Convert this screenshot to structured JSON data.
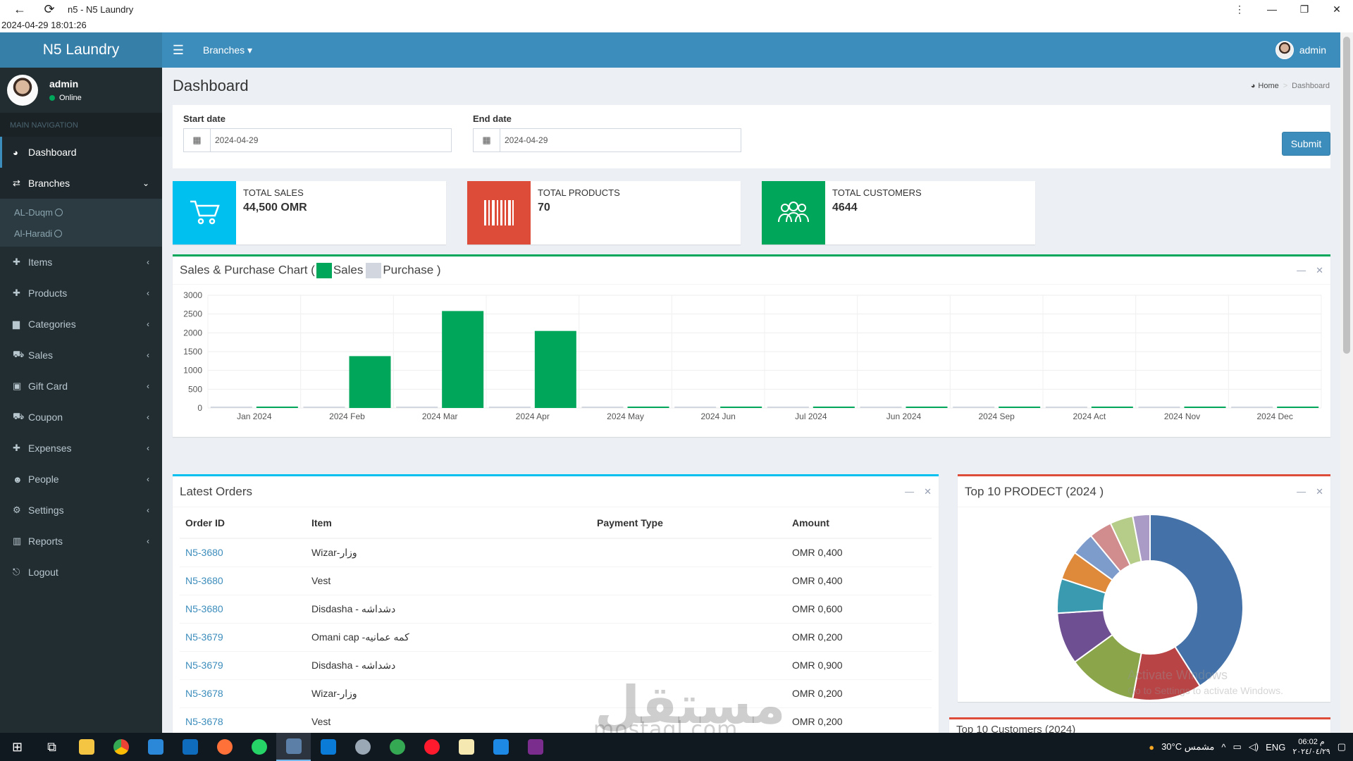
{
  "window": {
    "title": "n5 - N5 Laundry",
    "timestamp": "2024-04-29 18:01:26"
  },
  "header": {
    "logo": "N5 Laundry",
    "branches_label": "Branches ▾",
    "user": "admin"
  },
  "sidebar": {
    "user_name": "admin",
    "user_status": "Online",
    "nav_header": "MAIN NAVIGATION",
    "items": [
      {
        "label": "Dashboard",
        "icon": "dashboard-icon"
      },
      {
        "label": "Branches",
        "icon": "exchange-icon"
      },
      {
        "label": "Items",
        "icon": "plus-icon"
      },
      {
        "label": "Products",
        "icon": "plus-icon"
      },
      {
        "label": "Categories",
        "icon": "folder-icon"
      },
      {
        "label": "Sales",
        "icon": "cart-icon"
      },
      {
        "label": "Gift Card",
        "icon": "gift-icon"
      },
      {
        "label": "Coupon",
        "icon": "cart-icon"
      },
      {
        "label": "Expenses",
        "icon": "plus-icon"
      },
      {
        "label": "People",
        "icon": "users-icon"
      },
      {
        "label": "Settings",
        "icon": "cogs-icon"
      },
      {
        "label": "Reports",
        "icon": "bar-chart-icon"
      },
      {
        "label": "Logout",
        "icon": "logout-icon"
      }
    ],
    "branches_sub": [
      "AL-Duqm",
      "Al-Haradi"
    ]
  },
  "page": {
    "title": "Dashboard",
    "breadcrumb_home": "Home",
    "breadcrumb_current": "Dashboard"
  },
  "filter": {
    "start_label": "Start date",
    "start_value": "2024-04-29",
    "end_label": "End date",
    "end_value": "2024-04-29",
    "submit": "Submit"
  },
  "stats": [
    {
      "label": "TOTAL SALES",
      "value": "44,500 OMR",
      "color": "#00c0ef",
      "icon": "cart-icon"
    },
    {
      "label": "TOTAL PRODUCTS",
      "value": "70",
      "color": "#dd4b39",
      "icon": "barcode-icon"
    },
    {
      "label": "TOTAL CUSTOMERS",
      "value": "4644",
      "color": "#00a65a",
      "icon": "users-icon"
    }
  ],
  "sales_chart": {
    "title_prefix": "Sales & Purchase Chart (",
    "legend_sales": "Sales",
    "legend_purchase": "Purchase )",
    "sales_color": "#00a65a",
    "purchase_color": "#d2d6de"
  },
  "chart_data": [
    {
      "type": "bar",
      "title": "Sales & Purchase Chart",
      "categories": [
        "Jan 2024",
        "2024 Feb",
        "2024 Mar",
        "2024 Apr",
        "2024 May",
        "2024 Jun",
        "Jul 2024",
        "Jun 2024",
        "2024 Sep",
        "2024 Act",
        "2024 Nov",
        "2024 Dec"
      ],
      "series": [
        {
          "name": "Sales",
          "values": [
            0,
            1380,
            2580,
            2050,
            0,
            0,
            0,
            0,
            0,
            0,
            0,
            0
          ]
        },
        {
          "name": "Purchase",
          "values": [
            0,
            0,
            0,
            0,
            0,
            0,
            0,
            0,
            0,
            0,
            0,
            0
          ]
        }
      ],
      "yticks": [
        "0",
        "500",
        "1000",
        "1500",
        "2000",
        "2500",
        "3000"
      ],
      "ylim": [
        0,
        3000
      ],
      "grid": true
    },
    {
      "type": "pie",
      "title": "Top 10 PRODECT (2024 )",
      "values": [
        41,
        12,
        12,
        9,
        6,
        5,
        4,
        4,
        4,
        3
      ],
      "colors": [
        "#4472a8",
        "#b94446",
        "#8aa54a",
        "#6e4f91",
        "#3a9bb0",
        "#df8a3a",
        "#7d9ccc",
        "#d18c8e",
        "#b6cd8a",
        "#a99bc6"
      ]
    }
  ],
  "orders": {
    "title": "Latest Orders",
    "headers": [
      "Order ID",
      "Item",
      "Payment Type",
      "Amount"
    ],
    "rows": [
      {
        "id": "N5-3680",
        "item": "Wizar-وزار",
        "payment": "",
        "amount": "OMR 0,400"
      },
      {
        "id": "N5-3680",
        "item": "Vest",
        "payment": "",
        "amount": "OMR 0,400"
      },
      {
        "id": "N5-3680",
        "item": "Disdasha - دشداشه",
        "payment": "",
        "amount": "OMR 0,600"
      },
      {
        "id": "N5-3679",
        "item": "Omani cap -كمه عمانيه",
        "payment": "",
        "amount": "OMR 0,200"
      },
      {
        "id": "N5-3679",
        "item": "Disdasha - دشداشه",
        "payment": "",
        "amount": "OMR 0,900"
      },
      {
        "id": "N5-3678",
        "item": "Wizar-وزار",
        "payment": "",
        "amount": "OMR 0,200"
      },
      {
        "id": "N5-3678",
        "item": "Vest",
        "payment": "",
        "amount": "OMR 0,200"
      }
    ]
  },
  "top_products": {
    "title": "Top 10 PRODECT (2024 )",
    "next_box_title": "Top 10 Customers (2024)"
  },
  "watermark": {
    "activate_1": "Activate Windows",
    "activate_2": "Go to Settings to activate Windows.",
    "mostaql": "مستقل",
    "mostaql_sub": "mostaql.com"
  },
  "taskbar": {
    "weather": "30°C  مشمس",
    "lang": "ENG",
    "time": "06:02 م",
    "date": "٢٠٢٤/٠٤/٢٩"
  }
}
